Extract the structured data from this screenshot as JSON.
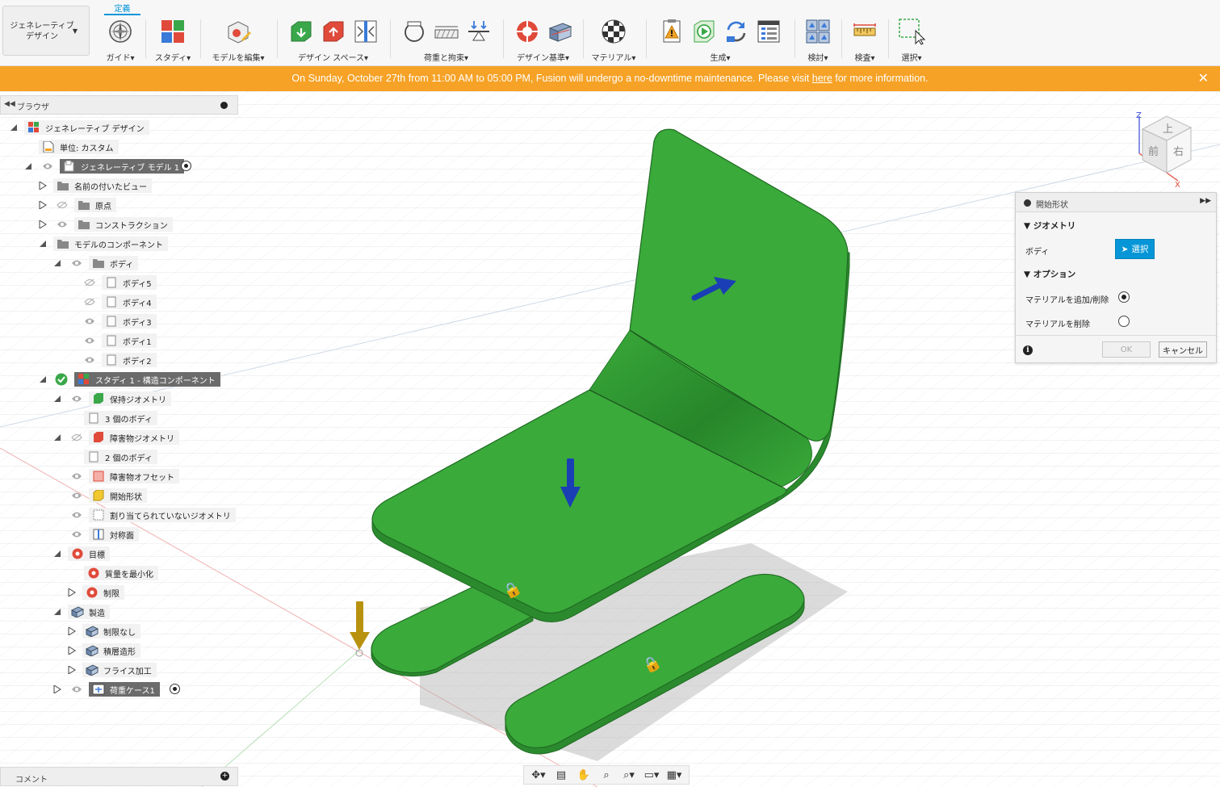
{
  "toolbar": {
    "workspace_label": "ジェネレーティブ\nデザイン",
    "active_tab": "定義",
    "groups": [
      {
        "label": "ガイド▾"
      },
      {
        "label": "スタディ▾"
      },
      {
        "label": "モデルを編集▾"
      },
      {
        "label": "デザイン スペース▾"
      },
      {
        "label": "荷重と拘束▾"
      },
      {
        "label": "デザイン基準▾"
      },
      {
        "label": "マテリアル▾"
      },
      {
        "label": "生成▾"
      },
      {
        "label": "検討▾"
      },
      {
        "label": "検査▾"
      },
      {
        "label": "選択▾"
      }
    ]
  },
  "banner": {
    "text_before": "On Sunday, October 27th from 11:00 AM to 05:00 PM, Fusion will undergo a no-downtime maintenance. Please visit ",
    "link": "here",
    "text_after": " for more information.",
    "close": "✕",
    "color": "#f6a226"
  },
  "browser": {
    "title": "ブラウザ",
    "items": [
      {
        "label": "ジェネレーティブ デザイン"
      },
      {
        "label": "単位: カスタム"
      },
      {
        "label": "ジェネレーティブ モデル 1"
      },
      {
        "label": "名前の付いたビュー"
      },
      {
        "label": "原点"
      },
      {
        "label": "コンストラクション"
      },
      {
        "label": "モデルのコンポーネント"
      },
      {
        "label": "ボディ"
      },
      {
        "label": "ボディ5"
      },
      {
        "label": "ボディ4"
      },
      {
        "label": "ボディ3"
      },
      {
        "label": "ボディ1"
      },
      {
        "label": "ボディ2"
      },
      {
        "label": "スタディ 1 - 構造コンポーネント"
      },
      {
        "label": "保持ジオメトリ"
      },
      {
        "label": "3 個のボディ"
      },
      {
        "label": "障害物ジオメトリ"
      },
      {
        "label": "2 個のボディ"
      },
      {
        "label": "障害物オフセット"
      },
      {
        "label": "開始形状"
      },
      {
        "label": "割り当てられていないジオメトリ"
      },
      {
        "label": "対称面"
      },
      {
        "label": "目標"
      },
      {
        "label": "質量を最小化"
      },
      {
        "label": "制限"
      },
      {
        "label": "製造"
      },
      {
        "label": "制限なし"
      },
      {
        "label": "積層造形"
      },
      {
        "label": "フライス加工"
      },
      {
        "label": "荷重ケース1"
      }
    ]
  },
  "comment": {
    "label": "コメント"
  },
  "dialog": {
    "title": "開始形状",
    "geometry_section": "ジオメトリ",
    "body_label": "ボディ",
    "select_button": "選択",
    "options_section": "オプション",
    "option_add_remove": "マテリアルを追加/削除",
    "option_remove": "マテリアルを削除",
    "selected_option": "add_remove",
    "ok": "OK",
    "cancel": "キャンセル"
  },
  "viewcube": {
    "face_top": "上",
    "face_front": "前",
    "face_right": "右",
    "axis_z": "Z",
    "axis_x": "X"
  },
  "colors": {
    "accent": "#0696d7",
    "model_green": "#3aaa3a",
    "load_arrow": "#1a3fb5",
    "constraint_arrow": "#b8920f"
  }
}
